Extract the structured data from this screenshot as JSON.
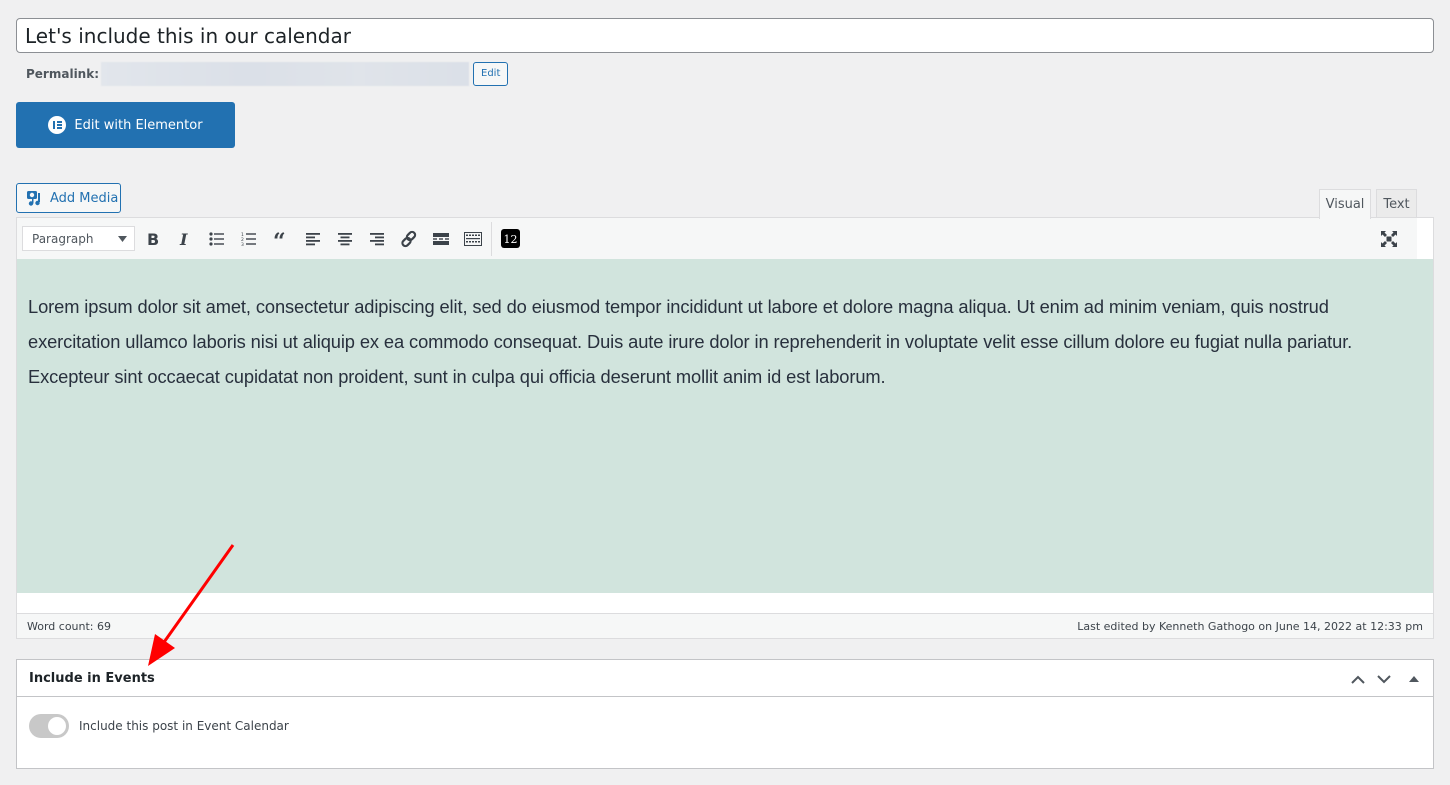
{
  "post": {
    "title": "Let's include this in our calendar",
    "permalink_label": "Permalink:",
    "permalink_edit_label": "Edit"
  },
  "elementor": {
    "label": "Edit with Elementor",
    "icon": "elementor-icon"
  },
  "media": {
    "label": "Add Media",
    "icon": "media-icon"
  },
  "editor": {
    "tabs": [
      {
        "label": "Visual",
        "active": true
      },
      {
        "label": "Text",
        "active": false
      }
    ],
    "format_select": {
      "value": "Paragraph"
    },
    "toolbar": [
      {
        "name": "bold",
        "icon": "bold-icon"
      },
      {
        "name": "italic",
        "icon": "italic-icon"
      },
      {
        "name": "bulleted-list",
        "icon": "bulleted-list-icon"
      },
      {
        "name": "numbered-list",
        "icon": "numbered-list-icon"
      },
      {
        "name": "blockquote",
        "icon": "blockquote-icon"
      },
      {
        "name": "align-left",
        "icon": "align-left-icon"
      },
      {
        "name": "align-center",
        "icon": "align-center-icon"
      },
      {
        "name": "align-right",
        "icon": "align-right-icon"
      },
      {
        "name": "link",
        "icon": "link-icon"
      },
      {
        "name": "read-more",
        "icon": "read-more-icon"
      },
      {
        "name": "toolbar-toggle",
        "icon": "keyboard-icon"
      },
      {
        "name": "shortcode",
        "icon": "shortcode-12-icon",
        "text": "12"
      },
      {
        "name": "fullscreen",
        "icon": "fullscreen-icon"
      }
    ],
    "content": "Lorem ipsum dolor sit amet, consectetur adipiscing elit, sed do eiusmod tempor incididunt ut labore et dolore magna aliqua. Ut enim ad minim veniam, quis nostrud exercitation ullamco laboris nisi ut aliquip ex ea commodo consequat. Duis aute irure dolor in reprehenderit in voluptate velit esse cillum dolore eu fugiat nulla pariatur. Excepteur sint occaecat cupidatat non proident, sunt in culpa qui officia deserunt mollit anim id est laborum.",
    "content_background": "#d1e4dd",
    "word_count": "Word count: 69",
    "last_edited": "Last edited by Kenneth Gathogo on June 14, 2022 at 12:33 pm"
  },
  "events_metabox": {
    "title": "Include in Events",
    "toggle_label": "Include this post in Event Calendar",
    "toggle_on": false
  },
  "annotation": {
    "color": "#ff0000",
    "type": "arrow"
  },
  "colors": {
    "accent": "#2271b1",
    "background": "#f0f0f1"
  }
}
